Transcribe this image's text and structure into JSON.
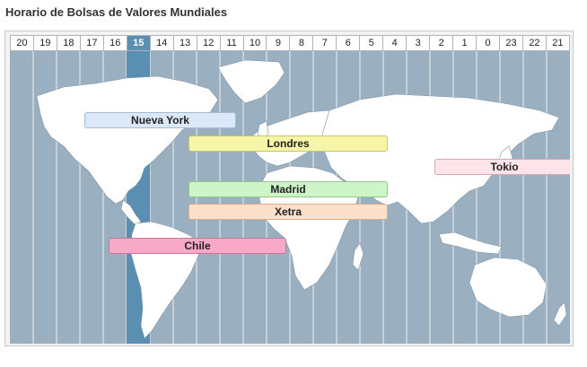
{
  "title": "Horario de Bolsas de Valores Mundiales",
  "hours": [
    "20",
    "19",
    "18",
    "17",
    "16",
    "15",
    "14",
    "13",
    "12",
    "11",
    "10",
    "9",
    "8",
    "7",
    "6",
    "5",
    "4",
    "3",
    "2",
    "1",
    "0",
    "23",
    "22",
    "21"
  ],
  "current_hour": "15",
  "colors": {
    "ocean": "#9aafc0",
    "land": "#ffffff",
    "grid": "#ffffff",
    "current_hour_column": "#5b8fb2"
  },
  "markets": [
    {
      "name": "Nueva York",
      "color": "#dbe8f8",
      "border": "#a6bcd6"
    },
    {
      "name": "Londres",
      "color": "#f7f5a8",
      "border": "#c9c56f"
    },
    {
      "name": "Tokio",
      "color": "#fde4e8",
      "border": "#d7a8b1"
    },
    {
      "name": "Madrid",
      "color": "#cdf5c8",
      "border": "#8fc988"
    },
    {
      "name": "Xetra",
      "color": "#fde0c9",
      "border": "#d6ae8d"
    },
    {
      "name": "Chile",
      "color": "#f8a9c7",
      "border": "#cf7398"
    }
  ]
}
